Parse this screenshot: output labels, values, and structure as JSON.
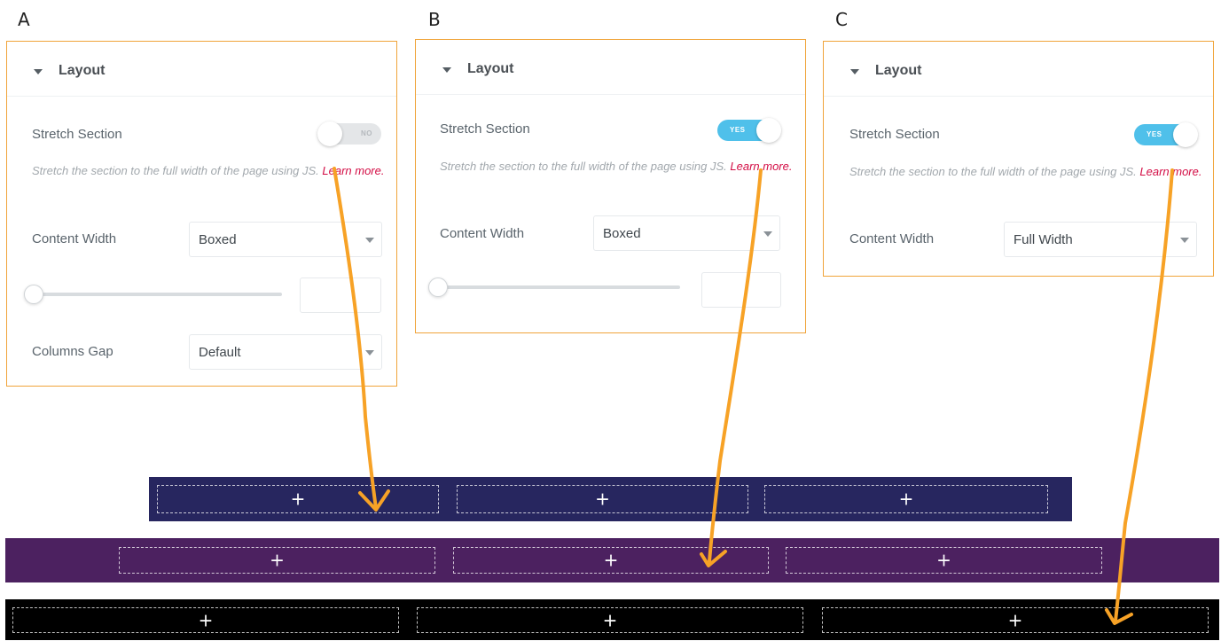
{
  "labels": {
    "a": "A",
    "b": "B",
    "c": "C"
  },
  "panel": {
    "title": "Layout",
    "stretch_label": "Stretch Section",
    "stretch_desc": "Stretch the section to the full width of the page using JS.",
    "learn_more": "Learn more.",
    "content_width_label": "Content Width",
    "columns_gap_label": "Columns Gap"
  },
  "panels": [
    {
      "toggle_on": false,
      "toggle_text": "NO",
      "content_width": "Boxed",
      "columns_gap": "Default"
    },
    {
      "toggle_on": true,
      "toggle_text": "YES",
      "content_width": "Boxed"
    },
    {
      "toggle_on": true,
      "toggle_text": "YES",
      "content_width": "Full Width"
    }
  ],
  "sections": [
    {
      "name": "boxed-section",
      "color": "#27265f",
      "plus": "+"
    },
    {
      "name": "stretched-boxed-section",
      "color": "#4c2160",
      "plus": "+"
    },
    {
      "name": "stretched-full-width-section",
      "color": "#000000",
      "plus": "+"
    }
  ],
  "colors": {
    "panel_border": "#f0a43a",
    "arrow": "#f7a226",
    "toggle_on": "#4fc0ea",
    "learn_more": "#d30c44"
  },
  "icons": {
    "caret": "caret-down-icon",
    "select_arrow": "dropdown-arrow-icon",
    "add": "plus-icon",
    "arrow": "hand-drawn-arrow"
  }
}
